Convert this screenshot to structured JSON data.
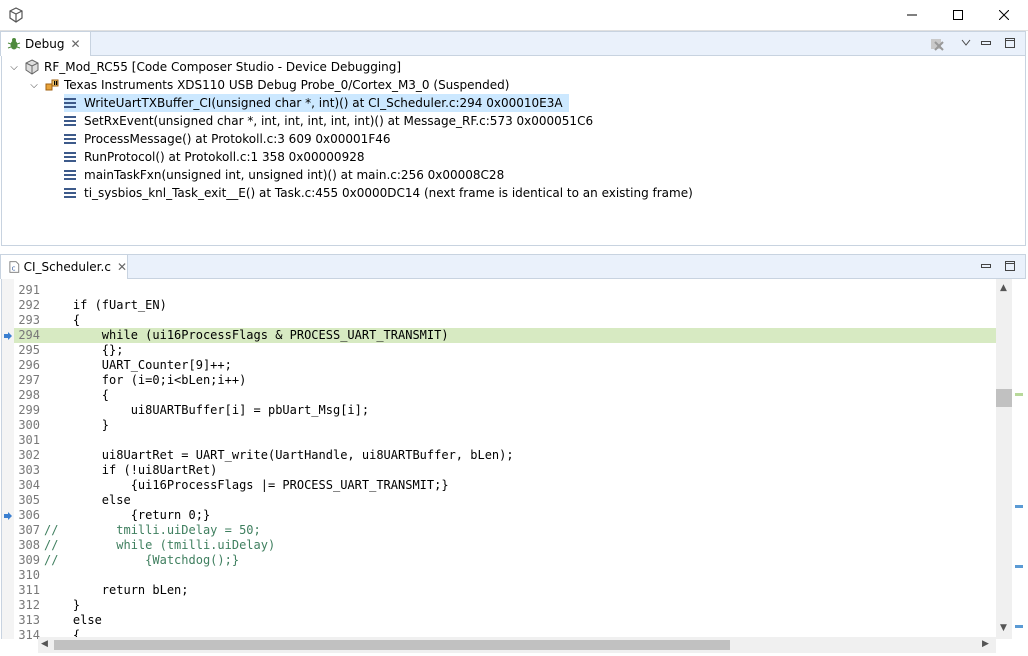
{
  "window": {
    "minimize": "—",
    "maximize": "☐",
    "close": "✕"
  },
  "debug_view": {
    "tab_label": "Debug",
    "tree": [
      {
        "label": "RF_Mod_RC55 [Code Composer Studio - Device Debugging]",
        "icon": "debug-session-icon"
      },
      {
        "label": "Texas Instruments XDS110 USB Debug Probe_0/Cortex_M3_0 (Suspended)",
        "icon": "suspended-thread-icon"
      },
      {
        "label": "WriteUartTXBuffer_CI(unsigned char *, int)() at CI_Scheduler.c:294 0x00010E3A",
        "icon": "stack-frame-icon"
      },
      {
        "label": "SetRxEvent(unsigned char *, int, int, int, int, int)() at Message_RF.c:573 0x000051C6",
        "icon": "stack-frame-icon"
      },
      {
        "label": "ProcessMessage() at Protokoll.c:3 609 0x00001F46",
        "icon": "stack-frame-icon"
      },
      {
        "label": "RunProtocol() at Protokoll.c:1 358 0x00000928",
        "icon": "stack-frame-icon"
      },
      {
        "label": "mainTaskFxn(unsigned int, unsigned int)() at main.c:256 0x00008C28",
        "icon": "stack-frame-icon"
      },
      {
        "label": "ti_sysbios_knl_Task_exit__E() at Task.c:455 0x0000DC14  (next frame is identical to an existing frame)",
        "icon": "stack-frame-icon"
      }
    ]
  },
  "editor": {
    "tab_label": "CI_Scheduler.c",
    "lines": [
      {
        "n": "291",
        "code": ""
      },
      {
        "n": "292",
        "code": "    if (fUart_EN)"
      },
      {
        "n": "293",
        "code": "    {"
      },
      {
        "n": "294",
        "code": "        while (ui16ProcessFlags & PROCESS_UART_TRANSMIT)"
      },
      {
        "n": "295",
        "code": "        {};"
      },
      {
        "n": "296",
        "code": "        UART_Counter[9]++;"
      },
      {
        "n": "297",
        "code": "        for (i=0;i<bLen;i++)"
      },
      {
        "n": "298",
        "code": "        {"
      },
      {
        "n": "299",
        "code": "            ui8UARTBuffer[i] = pbUart_Msg[i];"
      },
      {
        "n": "300",
        "code": "        }"
      },
      {
        "n": "301",
        "code": ""
      },
      {
        "n": "302",
        "code": "        ui8UartRet = UART_write(UartHandle, ui8UARTBuffer, bLen);"
      },
      {
        "n": "303",
        "code": "        if (!ui8UartRet)"
      },
      {
        "n": "304",
        "code": "            {ui16ProcessFlags |= PROCESS_UART_TRANSMIT;}"
      },
      {
        "n": "305",
        "code": "        else"
      },
      {
        "n": "306",
        "code": "            {return 0;}"
      },
      {
        "n": "307",
        "code": "//        tmilli.uiDelay = 50;"
      },
      {
        "n": "308",
        "code": "//        while (tmilli.uiDelay)"
      },
      {
        "n": "309",
        "code": "//            {Watchdog();}"
      },
      {
        "n": "310",
        "code": ""
      },
      {
        "n": "311",
        "code": "        return bLen;"
      },
      {
        "n": "312",
        "code": "    }"
      },
      {
        "n": "313",
        "code": "    else"
      },
      {
        "n": "314",
        "code": "    {"
      }
    ]
  },
  "colors": {
    "current_line": "#d7eac2",
    "selection": "#cce8ff",
    "comment": "#3f7f5f"
  }
}
